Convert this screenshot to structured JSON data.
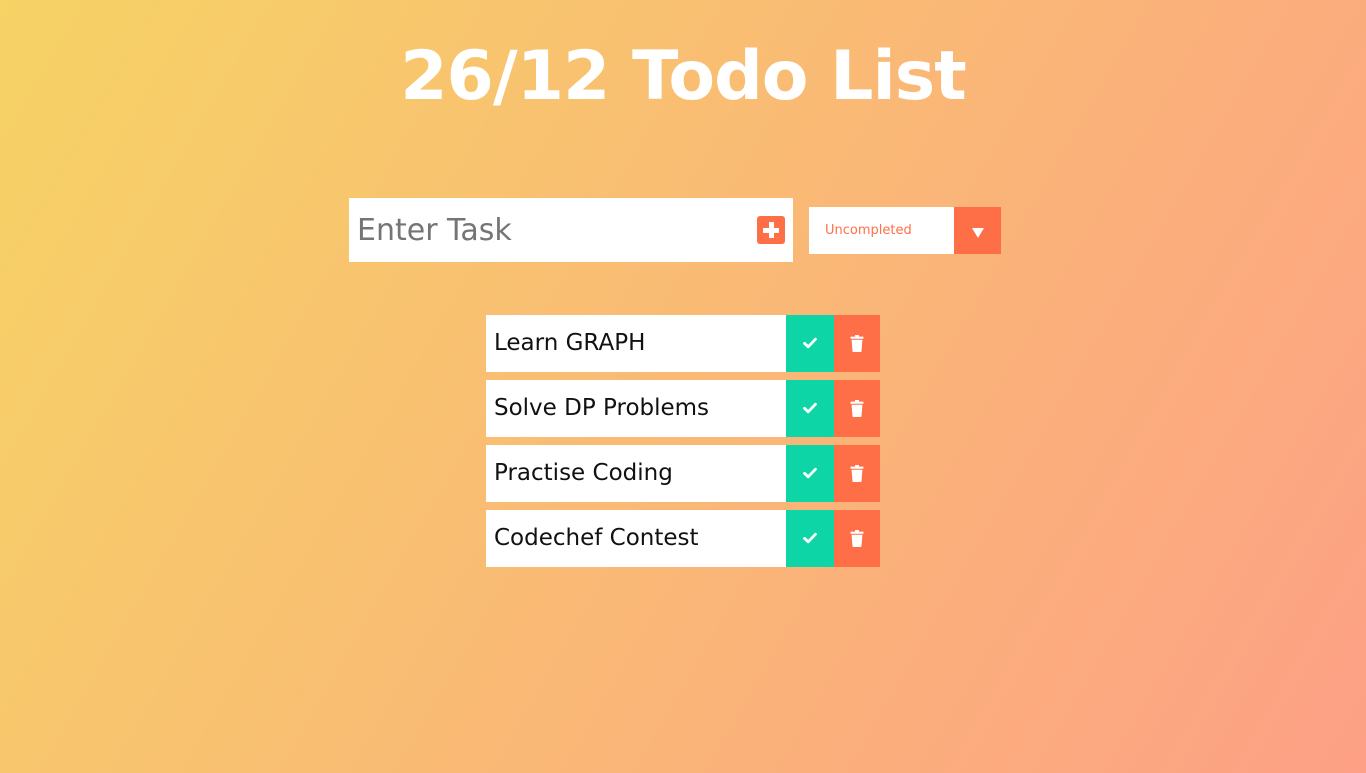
{
  "page": {
    "title": "26/12 Todo List"
  },
  "task_form": {
    "input_placeholder": "Enter Task",
    "add_icon": "plus-square-icon"
  },
  "filter": {
    "selected": "Uncompleted",
    "arrow_icon": "chevron-down-icon"
  },
  "todos": [
    {
      "text": "Learn GRAPH"
    },
    {
      "text": "Solve DP Problems"
    },
    {
      "text": "Practise Coding"
    },
    {
      "text": "Codechef Contest"
    }
  ],
  "icons": {
    "complete": "check-icon",
    "delete": "trash-icon"
  },
  "colors": {
    "background_start": "#f6d365",
    "background_end": "#fda085",
    "accent": "#ff6f47",
    "complete": "#0ed5a6"
  }
}
